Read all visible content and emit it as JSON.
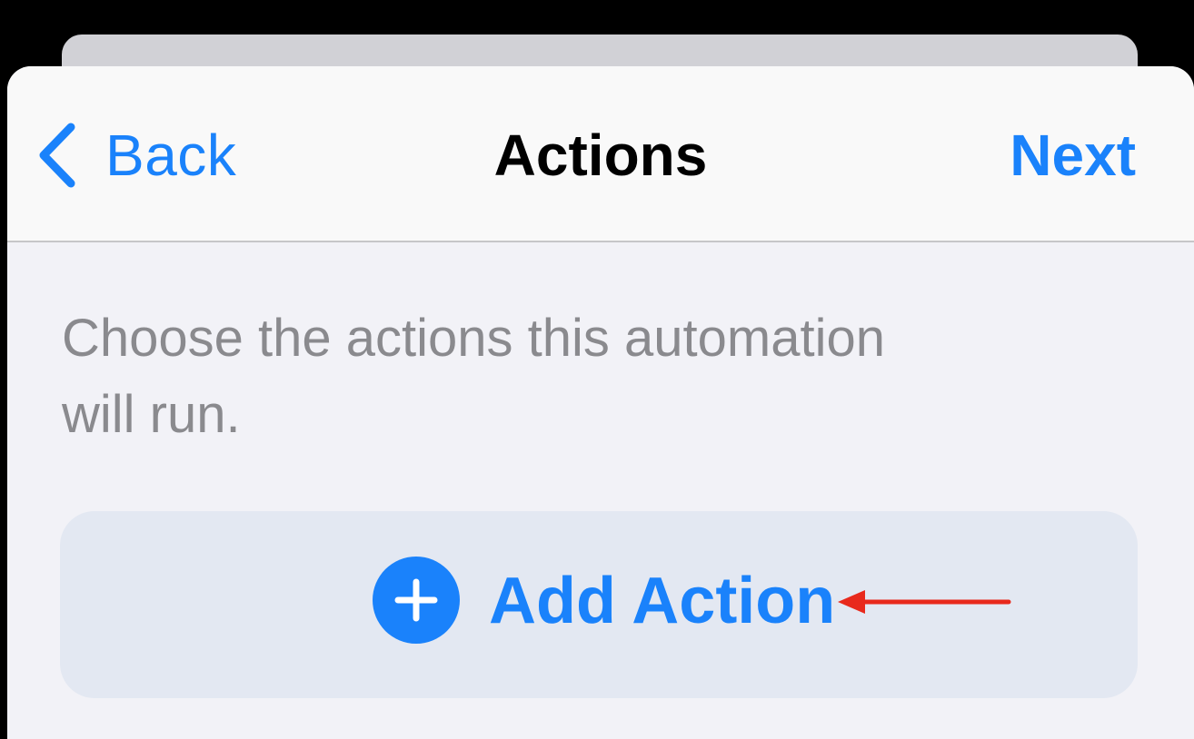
{
  "nav": {
    "back_label": "Back",
    "title": "Actions",
    "next_label": "Next"
  },
  "content": {
    "description_line1": "Choose the actions this automation",
    "description_line2": "will run.",
    "add_action_label": "Add Action"
  },
  "icons": {
    "back": "chevron-left-icon",
    "add": "plus-circle-icon",
    "annotation": "arrow-left-icon"
  },
  "colors": {
    "accent": "#1a82fb",
    "annotation": "#e8291c",
    "secondary_text": "#8a8a8e",
    "row_background": "#e3e8f2"
  }
}
